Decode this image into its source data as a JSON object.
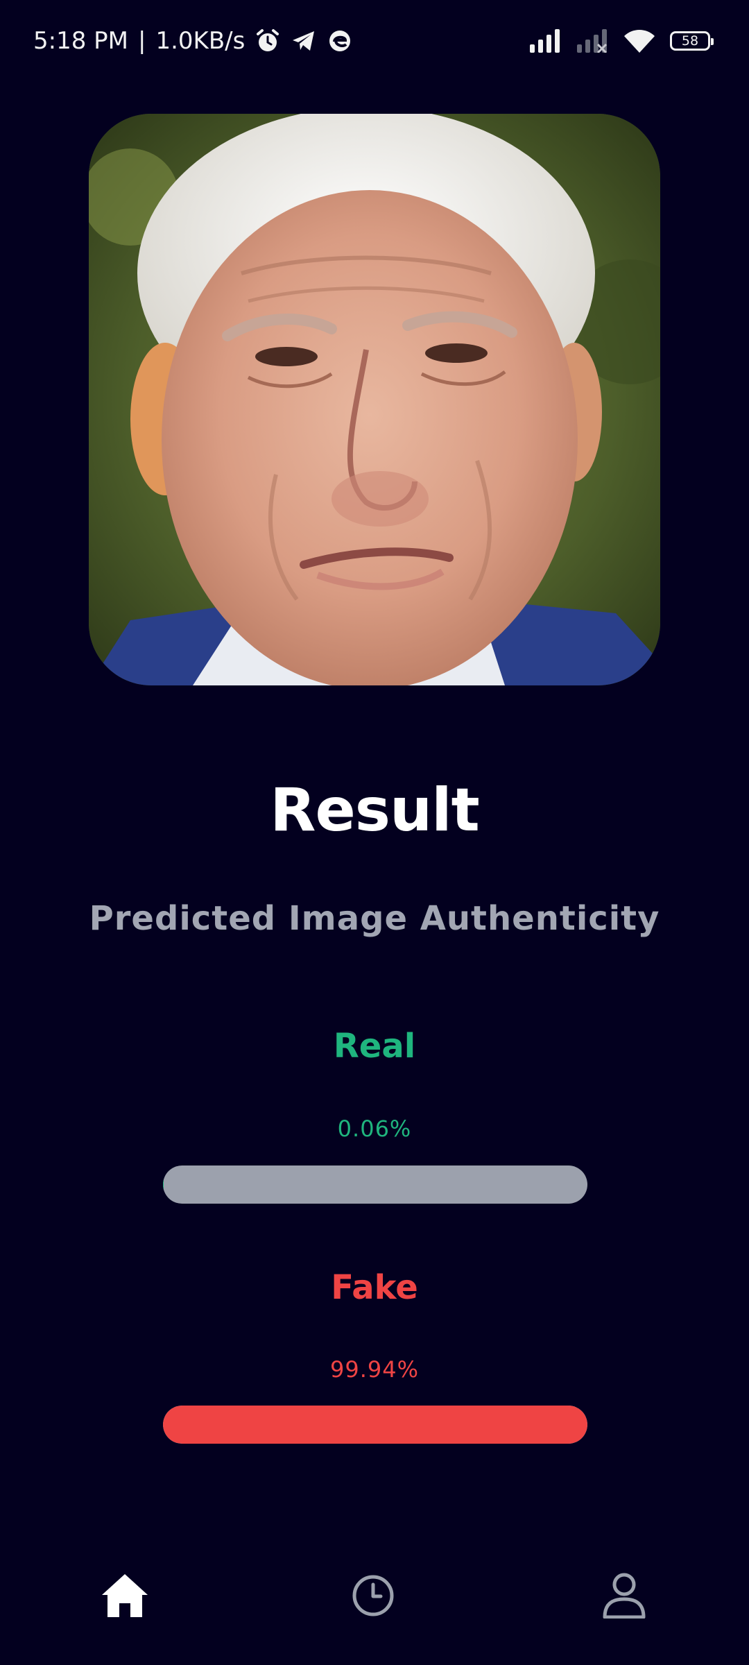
{
  "status_bar": {
    "time": "5:18 PM",
    "separator": "|",
    "net_speed": "1.0KB/s",
    "icons": [
      "alarm-icon",
      "telegram-icon",
      "edge-browser-icon",
      "signal-icon",
      "signal-weak-icon",
      "wifi-icon"
    ],
    "battery": "58"
  },
  "photo": {
    "icon": "portrait-photo"
  },
  "result": {
    "title": "Result",
    "subtitle": "Predicted Image Authenticity",
    "real": {
      "label": "Real",
      "percent_text": "0.06%",
      "value": 0.0006,
      "color": "#1fb57e"
    },
    "fake": {
      "label": "Fake",
      "percent_text": "99.94%",
      "value": 0.9994,
      "color": "#ef4444"
    },
    "track_color": "#9ca1ad"
  },
  "nav": {
    "items": [
      {
        "name": "home",
        "icon": "home-icon",
        "active": true
      },
      {
        "name": "history",
        "icon": "clock-icon",
        "active": false
      },
      {
        "name": "profile",
        "icon": "person-icon",
        "active": false
      }
    ]
  }
}
